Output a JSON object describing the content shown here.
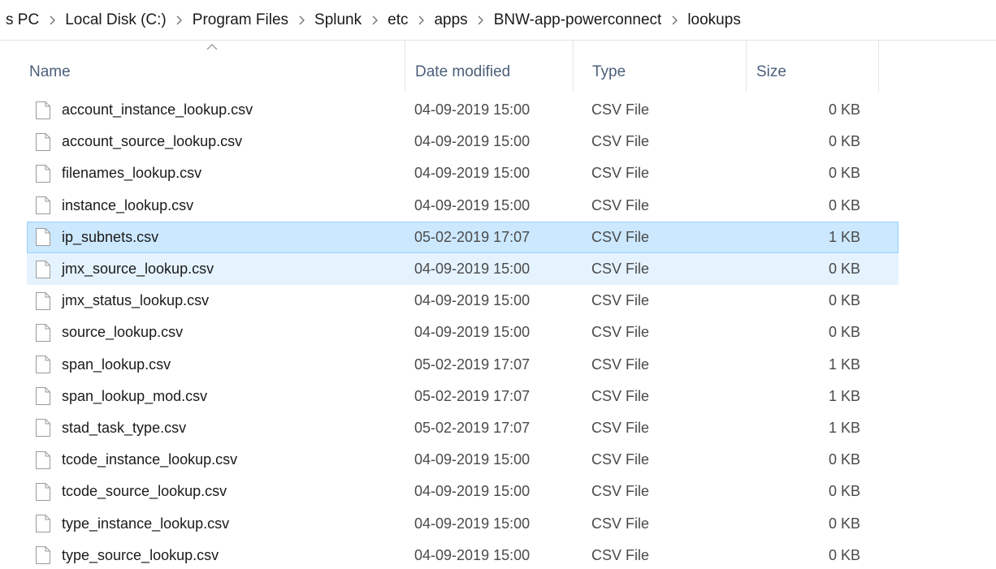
{
  "breadcrumb": [
    "s PC",
    "Local Disk (C:)",
    "Program Files",
    "Splunk",
    "etc",
    "apps",
    "BNW-app-powerconnect",
    "lookups"
  ],
  "columns": {
    "name": "Name",
    "date": "Date modified",
    "type": "Type",
    "size": "Size"
  },
  "sort": {
    "column": "name",
    "direction": "ascending",
    "icon": "sort-up-chevron-icon"
  },
  "icons": {
    "separator": "chevron-right-icon",
    "file": "blank-file-icon"
  },
  "colors": {
    "selected_bg": "#cce8ff",
    "selected_border": "#99d1ff",
    "hover_bg": "#e5f3ff",
    "header_text": "#4c607a"
  },
  "files": [
    {
      "name": "account_instance_lookup.csv",
      "date": "04-09-2019 15:00",
      "type": "CSV File",
      "size": "0 KB",
      "state": ""
    },
    {
      "name": "account_source_lookup.csv",
      "date": "04-09-2019 15:00",
      "type": "CSV File",
      "size": "0 KB",
      "state": ""
    },
    {
      "name": "filenames_lookup.csv",
      "date": "04-09-2019 15:00",
      "type": "CSV File",
      "size": "0 KB",
      "state": ""
    },
    {
      "name": "instance_lookup.csv",
      "date": "04-09-2019 15:00",
      "type": "CSV File",
      "size": "0 KB",
      "state": ""
    },
    {
      "name": "ip_subnets.csv",
      "date": "05-02-2019 17:07",
      "type": "CSV File",
      "size": "1 KB",
      "state": "selected"
    },
    {
      "name": "jmx_source_lookup.csv",
      "date": "04-09-2019 15:00",
      "type": "CSV File",
      "size": "0 KB",
      "state": "hover"
    },
    {
      "name": "jmx_status_lookup.csv",
      "date": "04-09-2019 15:00",
      "type": "CSV File",
      "size": "0 KB",
      "state": ""
    },
    {
      "name": "source_lookup.csv",
      "date": "04-09-2019 15:00",
      "type": "CSV File",
      "size": "0 KB",
      "state": ""
    },
    {
      "name": "span_lookup.csv",
      "date": "05-02-2019 17:07",
      "type": "CSV File",
      "size": "1 KB",
      "state": ""
    },
    {
      "name": "span_lookup_mod.csv",
      "date": "05-02-2019 17:07",
      "type": "CSV File",
      "size": "1 KB",
      "state": ""
    },
    {
      "name": "stad_task_type.csv",
      "date": "05-02-2019 17:07",
      "type": "CSV File",
      "size": "1 KB",
      "state": ""
    },
    {
      "name": "tcode_instance_lookup.csv",
      "date": "04-09-2019 15:00",
      "type": "CSV File",
      "size": "0 KB",
      "state": ""
    },
    {
      "name": "tcode_source_lookup.csv",
      "date": "04-09-2019 15:00",
      "type": "CSV File",
      "size": "0 KB",
      "state": ""
    },
    {
      "name": "type_instance_lookup.csv",
      "date": "04-09-2019 15:00",
      "type": "CSV File",
      "size": "0 KB",
      "state": ""
    },
    {
      "name": "type_source_lookup.csv",
      "date": "04-09-2019 15:00",
      "type": "CSV File",
      "size": "0 KB",
      "state": ""
    }
  ]
}
